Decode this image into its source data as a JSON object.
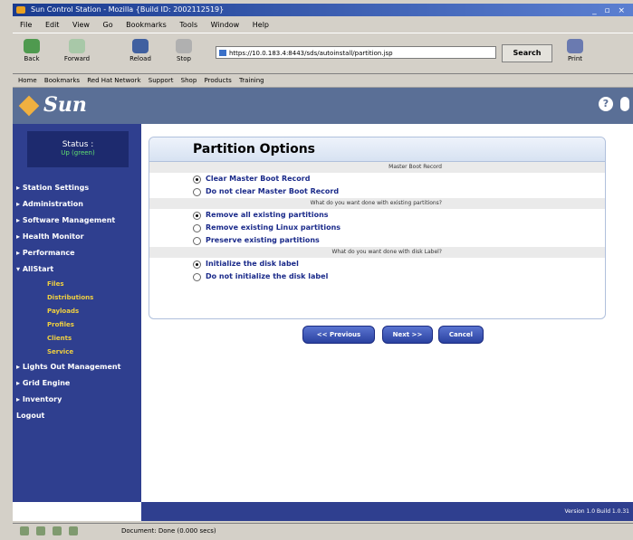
{
  "window": {
    "title": "Sun Control Station - Mozilla {Build ID: 2002112519}",
    "controls": "_ ▫ ×"
  },
  "menu": [
    "File",
    "Edit",
    "View",
    "Go",
    "Bookmarks",
    "Tools",
    "Window",
    "Help"
  ],
  "toolbar": {
    "back": "Back",
    "forward": "Forward",
    "reload": "Reload",
    "stop": "Stop",
    "url": "https://10.0.183.4:8443/sds/autoinstall/partition.jsp",
    "search": "Search",
    "print": "Print"
  },
  "bookmarks": [
    "Home",
    "Bookmarks",
    "Red Hat Network",
    "Support",
    "Shop",
    "Products",
    "Training"
  ],
  "header": {
    "logo": "Sun",
    "help": "?"
  },
  "sidebar": {
    "status_label": "Status :",
    "status_value": "Up (green)",
    "items": [
      "Station Settings",
      "Administration",
      "Software Management",
      "Health Monitor",
      "Performance",
      "AllStart"
    ],
    "allstart_sub": [
      "Files",
      "Distributions",
      "Payloads",
      "Profiles",
      "Clients",
      "Service"
    ],
    "items_after": [
      "Lights Out Management",
      "Grid Engine",
      "Inventory",
      "Logout"
    ]
  },
  "panel": {
    "title": "Partition Options",
    "sections": [
      {
        "heading": "Master Boot Record",
        "options": [
          {
            "label": "Clear Master Boot Record",
            "selected": true
          },
          {
            "label": "Do not clear Master Boot Record",
            "selected": false
          }
        ]
      },
      {
        "heading": "What do you want done with existing partitions?",
        "options": [
          {
            "label": "Remove all existing partitions",
            "selected": true
          },
          {
            "label": "Remove existing Linux partitions",
            "selected": false
          },
          {
            "label": "Preserve existing partitions",
            "selected": false
          }
        ]
      },
      {
        "heading": "What do you want done with disk Label?",
        "options": [
          {
            "label": "Initialize the disk label",
            "selected": true
          },
          {
            "label": "Do not initialize the disk label",
            "selected": false
          }
        ]
      }
    ]
  },
  "buttons": {
    "previous": "<< Previous",
    "next": "Next >>",
    "cancel": "Cancel"
  },
  "footer": {
    "version": "Version 1.0 Build 1.0.31"
  },
  "statusbar": {
    "text": "Document: Done (0.000 secs)"
  }
}
